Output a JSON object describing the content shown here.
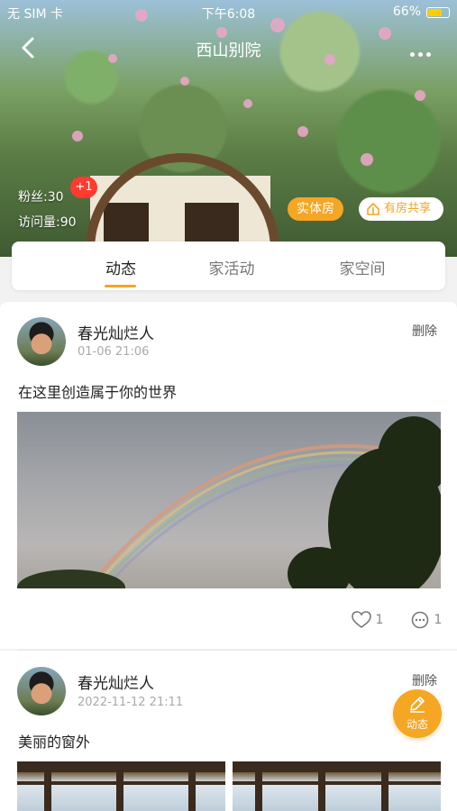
{
  "status_bar": {
    "carrier": "无 SIM 卡",
    "time": "下午6:08",
    "battery": "66%"
  },
  "header": {
    "title": "西山别院",
    "fans_label": "粉丝:30",
    "visits_label": "访问量:90",
    "badge": "+1",
    "tag_physical": "实体房",
    "tag_share": "有房共享"
  },
  "tabs": [
    {
      "label": "动态"
    },
    {
      "label": "家活动"
    },
    {
      "label": "家空间"
    }
  ],
  "posts": [
    {
      "user": "春光灿烂人",
      "time": "01-06 21:06",
      "delete_label": "删除",
      "text": "在这里创造属于你的世界",
      "likes": "1",
      "comments": "1"
    },
    {
      "user": "春光灿烂人",
      "time": "2022-11-12 21:11",
      "delete_label": "删除",
      "text": "美丽的窗外"
    }
  ],
  "fab": {
    "label": "动态"
  },
  "colors": {
    "accent": "#f5a623",
    "badge": "#ff3b30"
  }
}
